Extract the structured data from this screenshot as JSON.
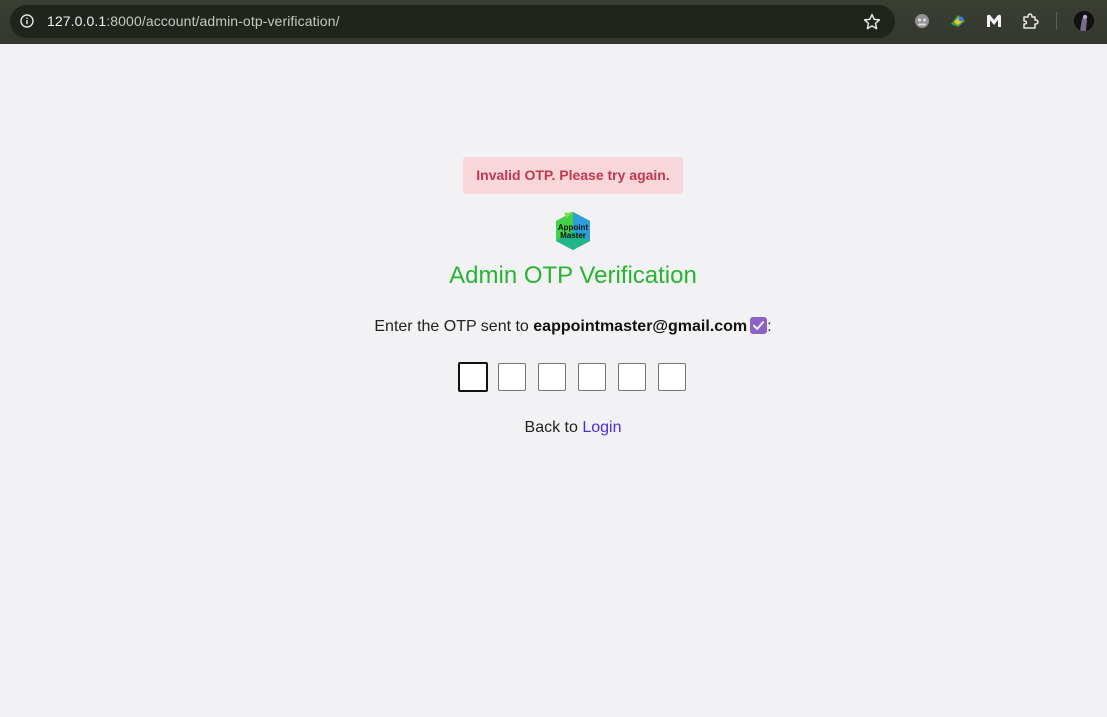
{
  "browser": {
    "url_host": "127.0.0.1",
    "url_rest": ":8000/account/admin-otp-verification/",
    "icons": [
      "info-icon",
      "star-icon",
      "extension-icon-1",
      "extension-icon-2",
      "malwarebytes-icon",
      "puzzle-icon",
      "profile-avatar"
    ]
  },
  "alert": {
    "text": "Invalid OTP. Please try again.",
    "bg_color": "#f8d7da",
    "text_color": "#c3384d"
  },
  "logo": {
    "line1": "Appoint",
    "line2": "Master"
  },
  "page": {
    "title": "Admin OTP Verification",
    "title_color": "#27b531",
    "instruction_prefix": "Enter the OTP sent to",
    "email": "eappointmaster@gmail.com",
    "instruction_suffix": ":",
    "otp_digits": [
      "",
      "",
      "",
      "",
      "",
      ""
    ],
    "back_prefix": "Back to",
    "login_label": "Login",
    "link_color": "#4a2fd6"
  }
}
